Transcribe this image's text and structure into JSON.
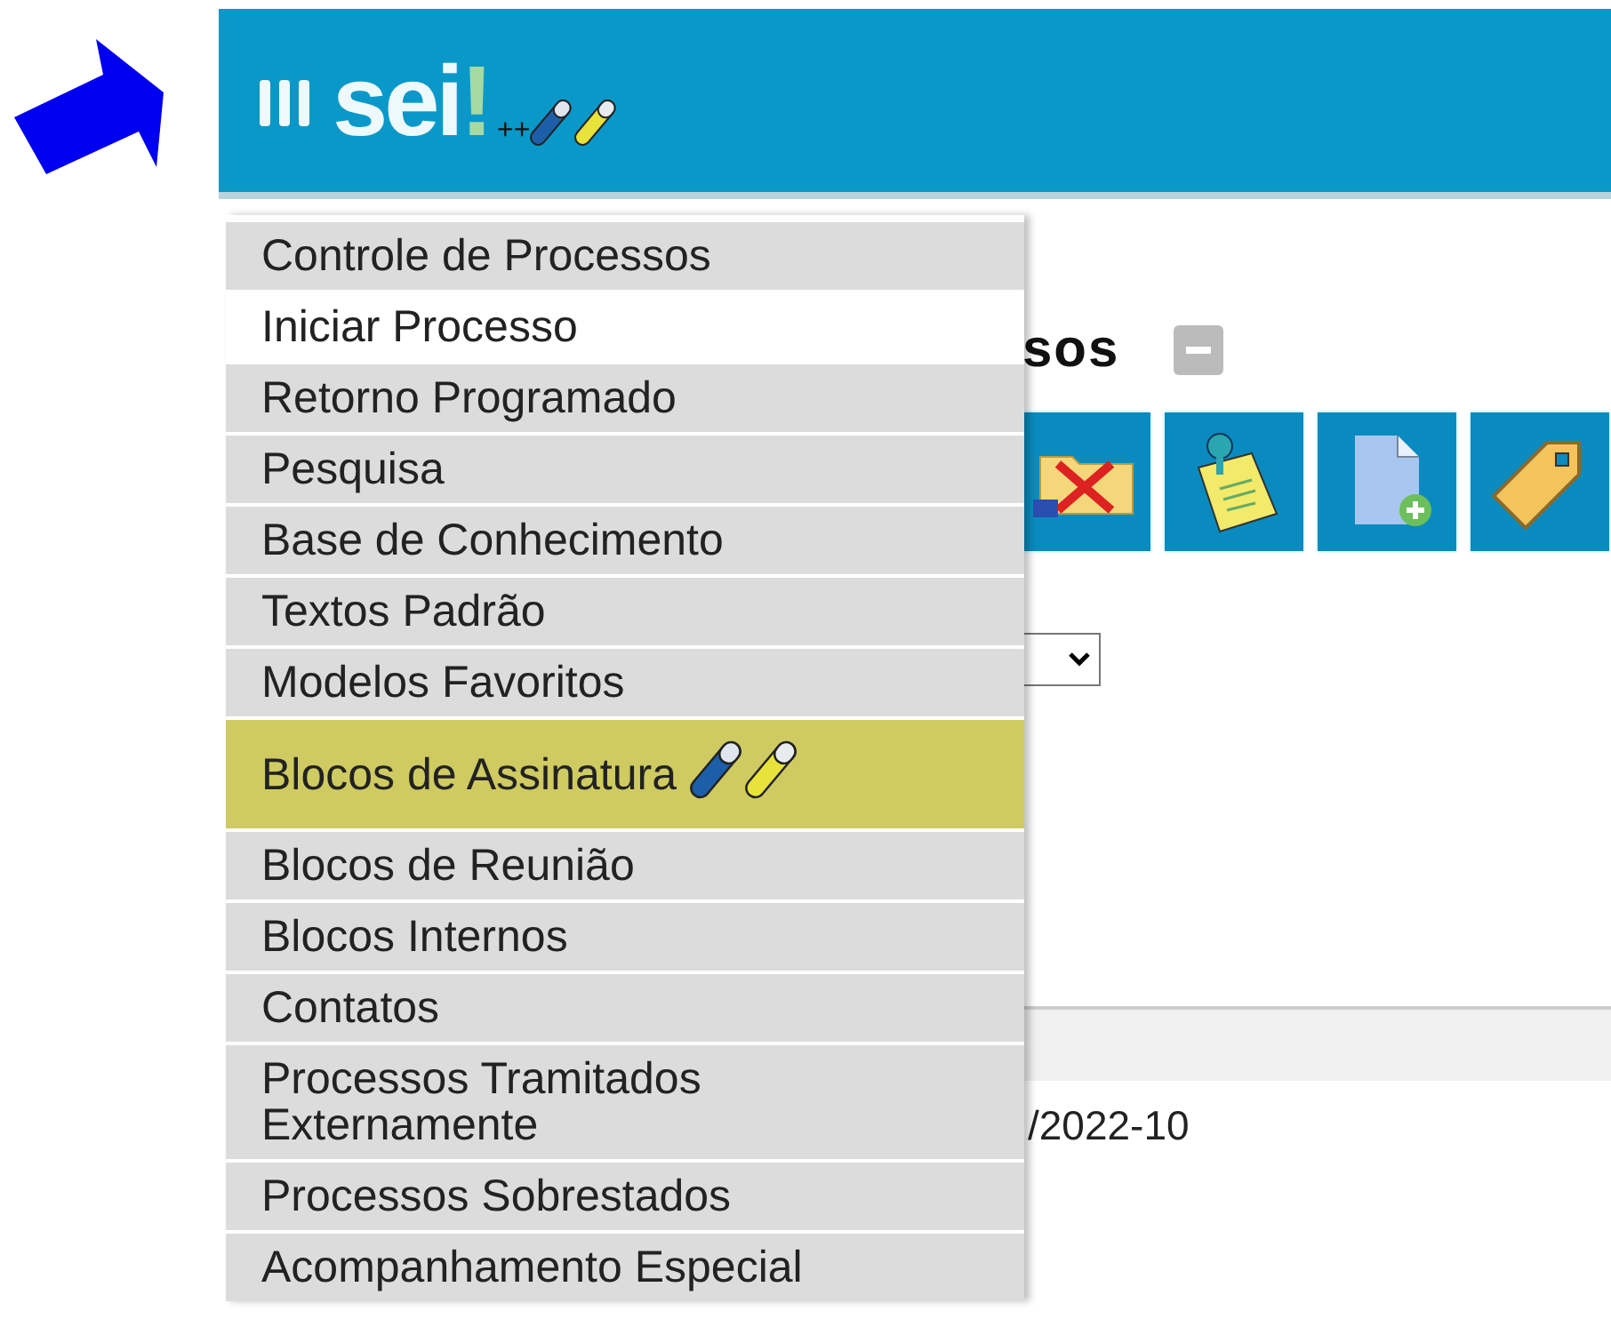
{
  "header": {
    "logo_text": "sei",
    "logo_mark": "!",
    "logo_suffix": "++"
  },
  "page": {
    "title": "sos",
    "date_fragment": "/2022-10"
  },
  "menu": [
    {
      "label": "Controle de Processos",
      "selected": false,
      "highlighted": false,
      "pens": false
    },
    {
      "label": "Iniciar Processo",
      "selected": true,
      "highlighted": false,
      "pens": false
    },
    {
      "label": "Retorno Programado",
      "selected": false,
      "highlighted": false,
      "pens": false
    },
    {
      "label": "Pesquisa",
      "selected": false,
      "highlighted": false,
      "pens": false
    },
    {
      "label": "Base de Conhecimento",
      "selected": false,
      "highlighted": false,
      "pens": false
    },
    {
      "label": "Textos Padrão",
      "selected": false,
      "highlighted": false,
      "pens": false
    },
    {
      "label": "Modelos Favoritos",
      "selected": false,
      "highlighted": false,
      "pens": false
    },
    {
      "label": "Blocos de Assinatura",
      "selected": false,
      "highlighted": true,
      "pens": true
    },
    {
      "label": "Blocos de Reunião",
      "selected": false,
      "highlighted": false,
      "pens": false
    },
    {
      "label": "Blocos Internos",
      "selected": false,
      "highlighted": false,
      "pens": false
    },
    {
      "label": "Contatos",
      "selected": false,
      "highlighted": false,
      "pens": false
    },
    {
      "label": "Processos Tramitados Externamente",
      "selected": false,
      "highlighted": false,
      "pens": false
    },
    {
      "label": "Processos Sobrestados",
      "selected": false,
      "highlighted": false,
      "pens": false
    },
    {
      "label": "Acompanhamento Especial",
      "selected": false,
      "highlighted": false,
      "pens": false
    }
  ]
}
